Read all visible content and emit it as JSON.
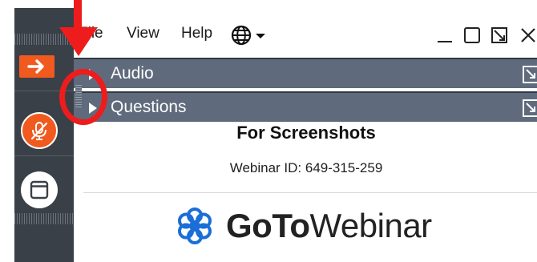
{
  "menu": {
    "file": "File",
    "view": "View",
    "help": "Help"
  },
  "sections": {
    "audio": "Audio",
    "questions": "Questions"
  },
  "session": {
    "title": "For Screenshots",
    "webinar_id": "Webinar ID: 649-315-259"
  },
  "logo": {
    "brand_bold": "GoTo",
    "brand_rest": "Webinar"
  },
  "icons": {
    "toolbar_arrow": "arrow-right-icon",
    "mic": "mic-muted-icon",
    "screen": "screen-share-icon",
    "language": "globe-icon",
    "section_caret": "caret-right-icon",
    "section_popout": "popout-icon",
    "logo_mark": "flower-logo-icon"
  },
  "colors": {
    "accent_orange": "#f05a1e",
    "section_bar": "#5f6b7c",
    "toolbar_bg": "#3a4048",
    "annotation_red": "#ee1c1c"
  }
}
